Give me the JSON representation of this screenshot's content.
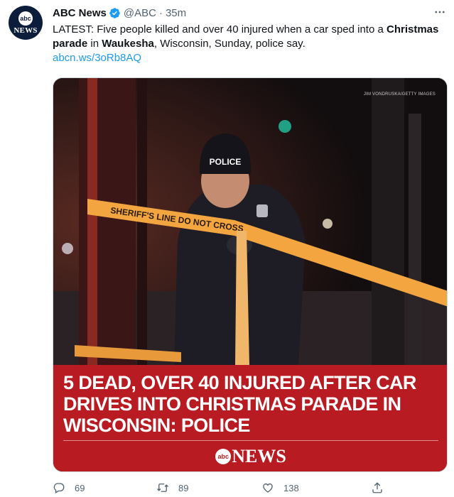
{
  "tweet": {
    "author_name": "ABC News",
    "handle": "@ABC",
    "separator": "·",
    "time": "35m",
    "avatar": {
      "logo_text": "abc",
      "wordmark": "NEWS"
    },
    "text_parts": [
      {
        "t": "LATEST: Five people killed and over 40 injured when a car sped into a ",
        "bold": false
      },
      {
        "t": "Christmas parade",
        "bold": true
      },
      {
        "t": " in ",
        "bold": false
      },
      {
        "t": "Waukesha",
        "bold": true
      },
      {
        "t": ", Wisconsin, Sunday, police say.",
        "bold": false
      }
    ],
    "link": "abcn.ws/3oRb8AQ"
  },
  "media": {
    "photo_credit": "JIM VONDRUSKA/GETTY IMAGES",
    "cap_text": "POLICE",
    "tape_text": "SHERIFF'S LINE DO NOT CROSS",
    "headline": "5 DEAD, OVER 40 INJURED AFTER CAR DRIVES INTO CHRISTMAS PARADE IN WISCONSIN: POLICE",
    "logo_circle": "abc",
    "logo_word": "NEWS"
  },
  "actions": {
    "replies": "69",
    "retweets": "89",
    "likes": "138"
  },
  "colors": {
    "link": "#1d9bf0",
    "verified": "#1d9bf0",
    "banner": "#b81c22",
    "muted": "#536471"
  }
}
